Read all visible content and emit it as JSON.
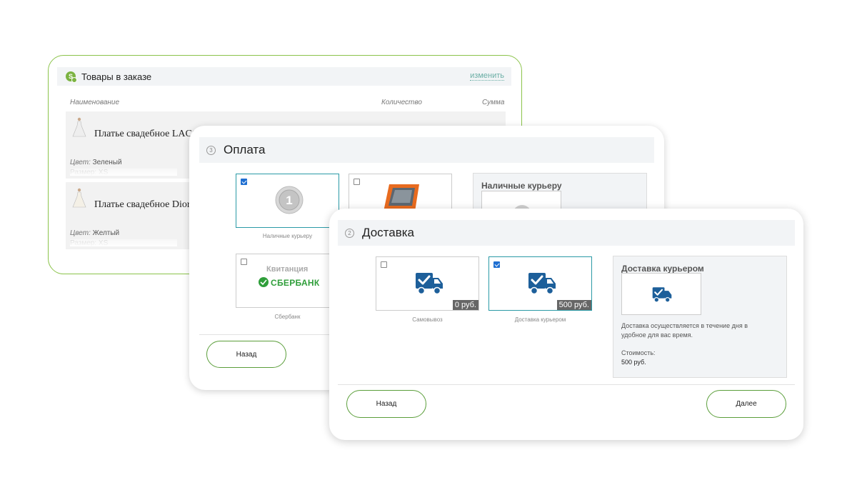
{
  "items_card": {
    "title": "Товары в заказе",
    "change_link": "изменить",
    "columns": {
      "name": "Наименование",
      "qty": "Количество",
      "sum": "Сумма"
    },
    "products": [
      {
        "name": "Платье свадебное LACC",
        "color_label": "Цвет:",
        "color_value": "Зеленый",
        "size_faded": "Размер: XS"
      },
      {
        "name": "Платье свадебное Dior",
        "color_label": "Цвет:",
        "color_value": "Желтый",
        "size_faded": "Размер: XS"
      }
    ]
  },
  "payment_card": {
    "step": "3",
    "title": "Оплата",
    "options": [
      {
        "caption": "Наличные курьеру",
        "selected": true
      },
      {
        "caption": "",
        "selected": false
      },
      {
        "caption": "Сбербанк",
        "selected": false,
        "logo_top": "Квитанция",
        "logo_bottom": "СБЕРБАНК"
      }
    ],
    "info_title": "Наличные курьеру",
    "back_button": "Назад"
  },
  "delivery_card": {
    "step": "2",
    "title": "Доставка",
    "options": [
      {
        "caption": "Самовывоз",
        "price": "0 руб.",
        "selected": false
      },
      {
        "caption": "Доставка курьером",
        "price": "500 руб.",
        "selected": true
      }
    ],
    "info_title": "Доставка курьером",
    "info_text_1": "Доставка осуществляется в течение дня в",
    "info_text_2": "удобное для вас время.",
    "cost_label": "Стоимость:",
    "cost_value": "500 руб.",
    "back_button": "Назад",
    "next_button": "Далее"
  },
  "colors": {
    "accent_green": "#5b9e3a",
    "truck_blue": "#1d5f9a",
    "select_teal": "#2a9aa6"
  },
  "icons": [
    "coin-icon",
    "terminal-icon",
    "sberbank-logo",
    "delivery-truck-icon",
    "dress-icon"
  ]
}
